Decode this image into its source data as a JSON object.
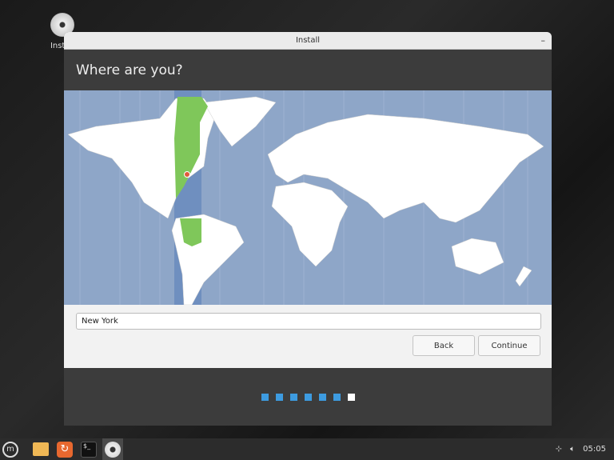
{
  "desktop": {
    "icon_label": "Install"
  },
  "window": {
    "title": "Install",
    "minimize": "–"
  },
  "header": {
    "title": "Where are you?"
  },
  "location": {
    "value": "New York"
  },
  "buttons": {
    "back": "Back",
    "continue": "Continue"
  },
  "progress": {
    "total_steps": 7,
    "current_step": 7
  },
  "taskbar": {
    "clock": "05:05",
    "items": [
      "menu",
      "files",
      "firefox",
      "terminal",
      "installer"
    ]
  },
  "colors": {
    "ocean": "#8ea6c8",
    "land": "#ffffff",
    "selected_zone": "#7fc75a",
    "accent": "#3d9be0"
  }
}
